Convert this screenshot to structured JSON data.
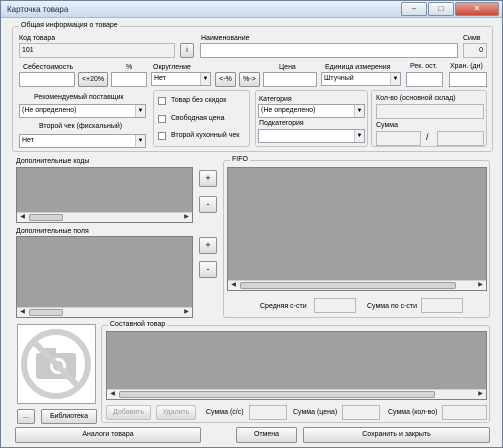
{
  "window": {
    "title": "Карточка товара",
    "min": "–",
    "max": "□",
    "close": "✕"
  },
  "general": {
    "legend": "Общая информация  о товаре",
    "code_label": "Код товара",
    "code_value": "101",
    "info_button": "i",
    "name_label": "Наименование",
    "name_value": "",
    "sym_label": "Симв",
    "sym_value": "0"
  },
  "pricing": {
    "cost_label": "Себестоимость",
    "cost_value": "",
    "plus20": "<+20%",
    "percent_label": "%",
    "percent_value": "",
    "rounding_label": "Округление",
    "rounding_value": "Нет",
    "minus_pct": "<-%",
    "pct_minus": "%->",
    "price_label": "Цена",
    "price_value": "",
    "unit_label": "Единица измерения",
    "unit_value": "Штучный",
    "rec_rest_label": "Рек. ост.",
    "rec_rest_value": "",
    "storage_label": "Хран. (дн)",
    "storage_value": ""
  },
  "supplier": {
    "label": "Рекомендуемый поставщик",
    "value": "(Не определено)",
    "second_check_label": "Второй чек (фискальный)",
    "second_check_value": "Нет"
  },
  "flags": {
    "no_discount": "Товар без скидок",
    "free_price": "Свободная цена",
    "second_kitchen": "Второй кухонный чек"
  },
  "category": {
    "label": "Категория",
    "value": "(Не определено)",
    "sub_label": "Подкатегория",
    "sub_value": ""
  },
  "stock": {
    "qty_label": "Кол-во (основной склад)",
    "sum_label": "Сумма",
    "slash": "/"
  },
  "extra_codes": {
    "label": "Дополнительные коды",
    "add": "+",
    "remove": "-"
  },
  "extra_fields": {
    "label": "Дополнительные поля",
    "add": "+",
    "remove": "-"
  },
  "fifo": {
    "label": "FIFO",
    "avg_cost_label": "Средняя с-сти",
    "sum_cost_label": "Сумма по с-сти"
  },
  "photo": {
    "browse": "...",
    "library": "Библиотека"
  },
  "composite": {
    "label": "Составной товар",
    "add": "Добавить",
    "remove": "Удалить",
    "sum_cost_label": "Сумма (с/с)",
    "sum_price_label": "Сумма (цена)",
    "sum_qty_label": "Сумма (кол-во)"
  },
  "footer": {
    "analogs": "Аналоги товара",
    "cancel": "Отмена",
    "save_close": "Сохранить и закрыть"
  }
}
